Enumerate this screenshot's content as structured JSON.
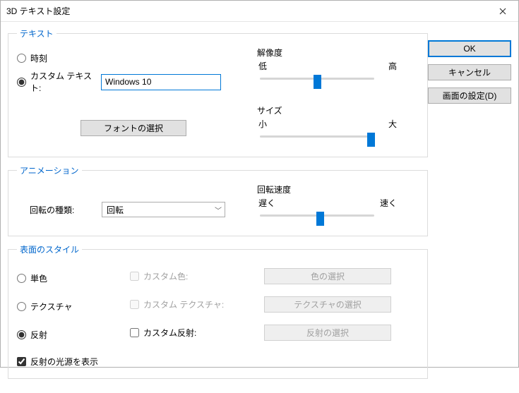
{
  "window": {
    "title": "3D テキスト設定"
  },
  "buttons": {
    "ok": "OK",
    "cancel": "キャンセル",
    "display_settings": "画面の設定(D)"
  },
  "text_group": {
    "legend": "テキスト",
    "radio_time": "時刻",
    "radio_custom": "カスタム テキスト:",
    "custom_value": "Windows 10",
    "font_button": "フォントの選択",
    "resolution": {
      "title": "解像度",
      "low": "低",
      "high": "高"
    },
    "size": {
      "title": "サイズ",
      "small": "小",
      "large": "大"
    }
  },
  "anim_group": {
    "legend": "アニメーション",
    "rotation_type_label": "回転の種類:",
    "rotation_type_value": "回転",
    "speed": {
      "title": "回転速度",
      "slow": "遅く",
      "fast": "速く"
    }
  },
  "style_group": {
    "legend": "表面のスタイル",
    "radio_solid": "単色",
    "radio_texture": "テクスチャ",
    "radio_reflect": "反射",
    "cb_custom_color": "カスタム色:",
    "cb_custom_texture": "カスタム テクスチャ:",
    "cb_custom_reflect": "カスタム反射:",
    "btn_color": "色の選択",
    "btn_texture": "テクスチャの選択",
    "btn_reflect": "反射の選択",
    "cb_show_specular": "反射の光源を表示"
  }
}
